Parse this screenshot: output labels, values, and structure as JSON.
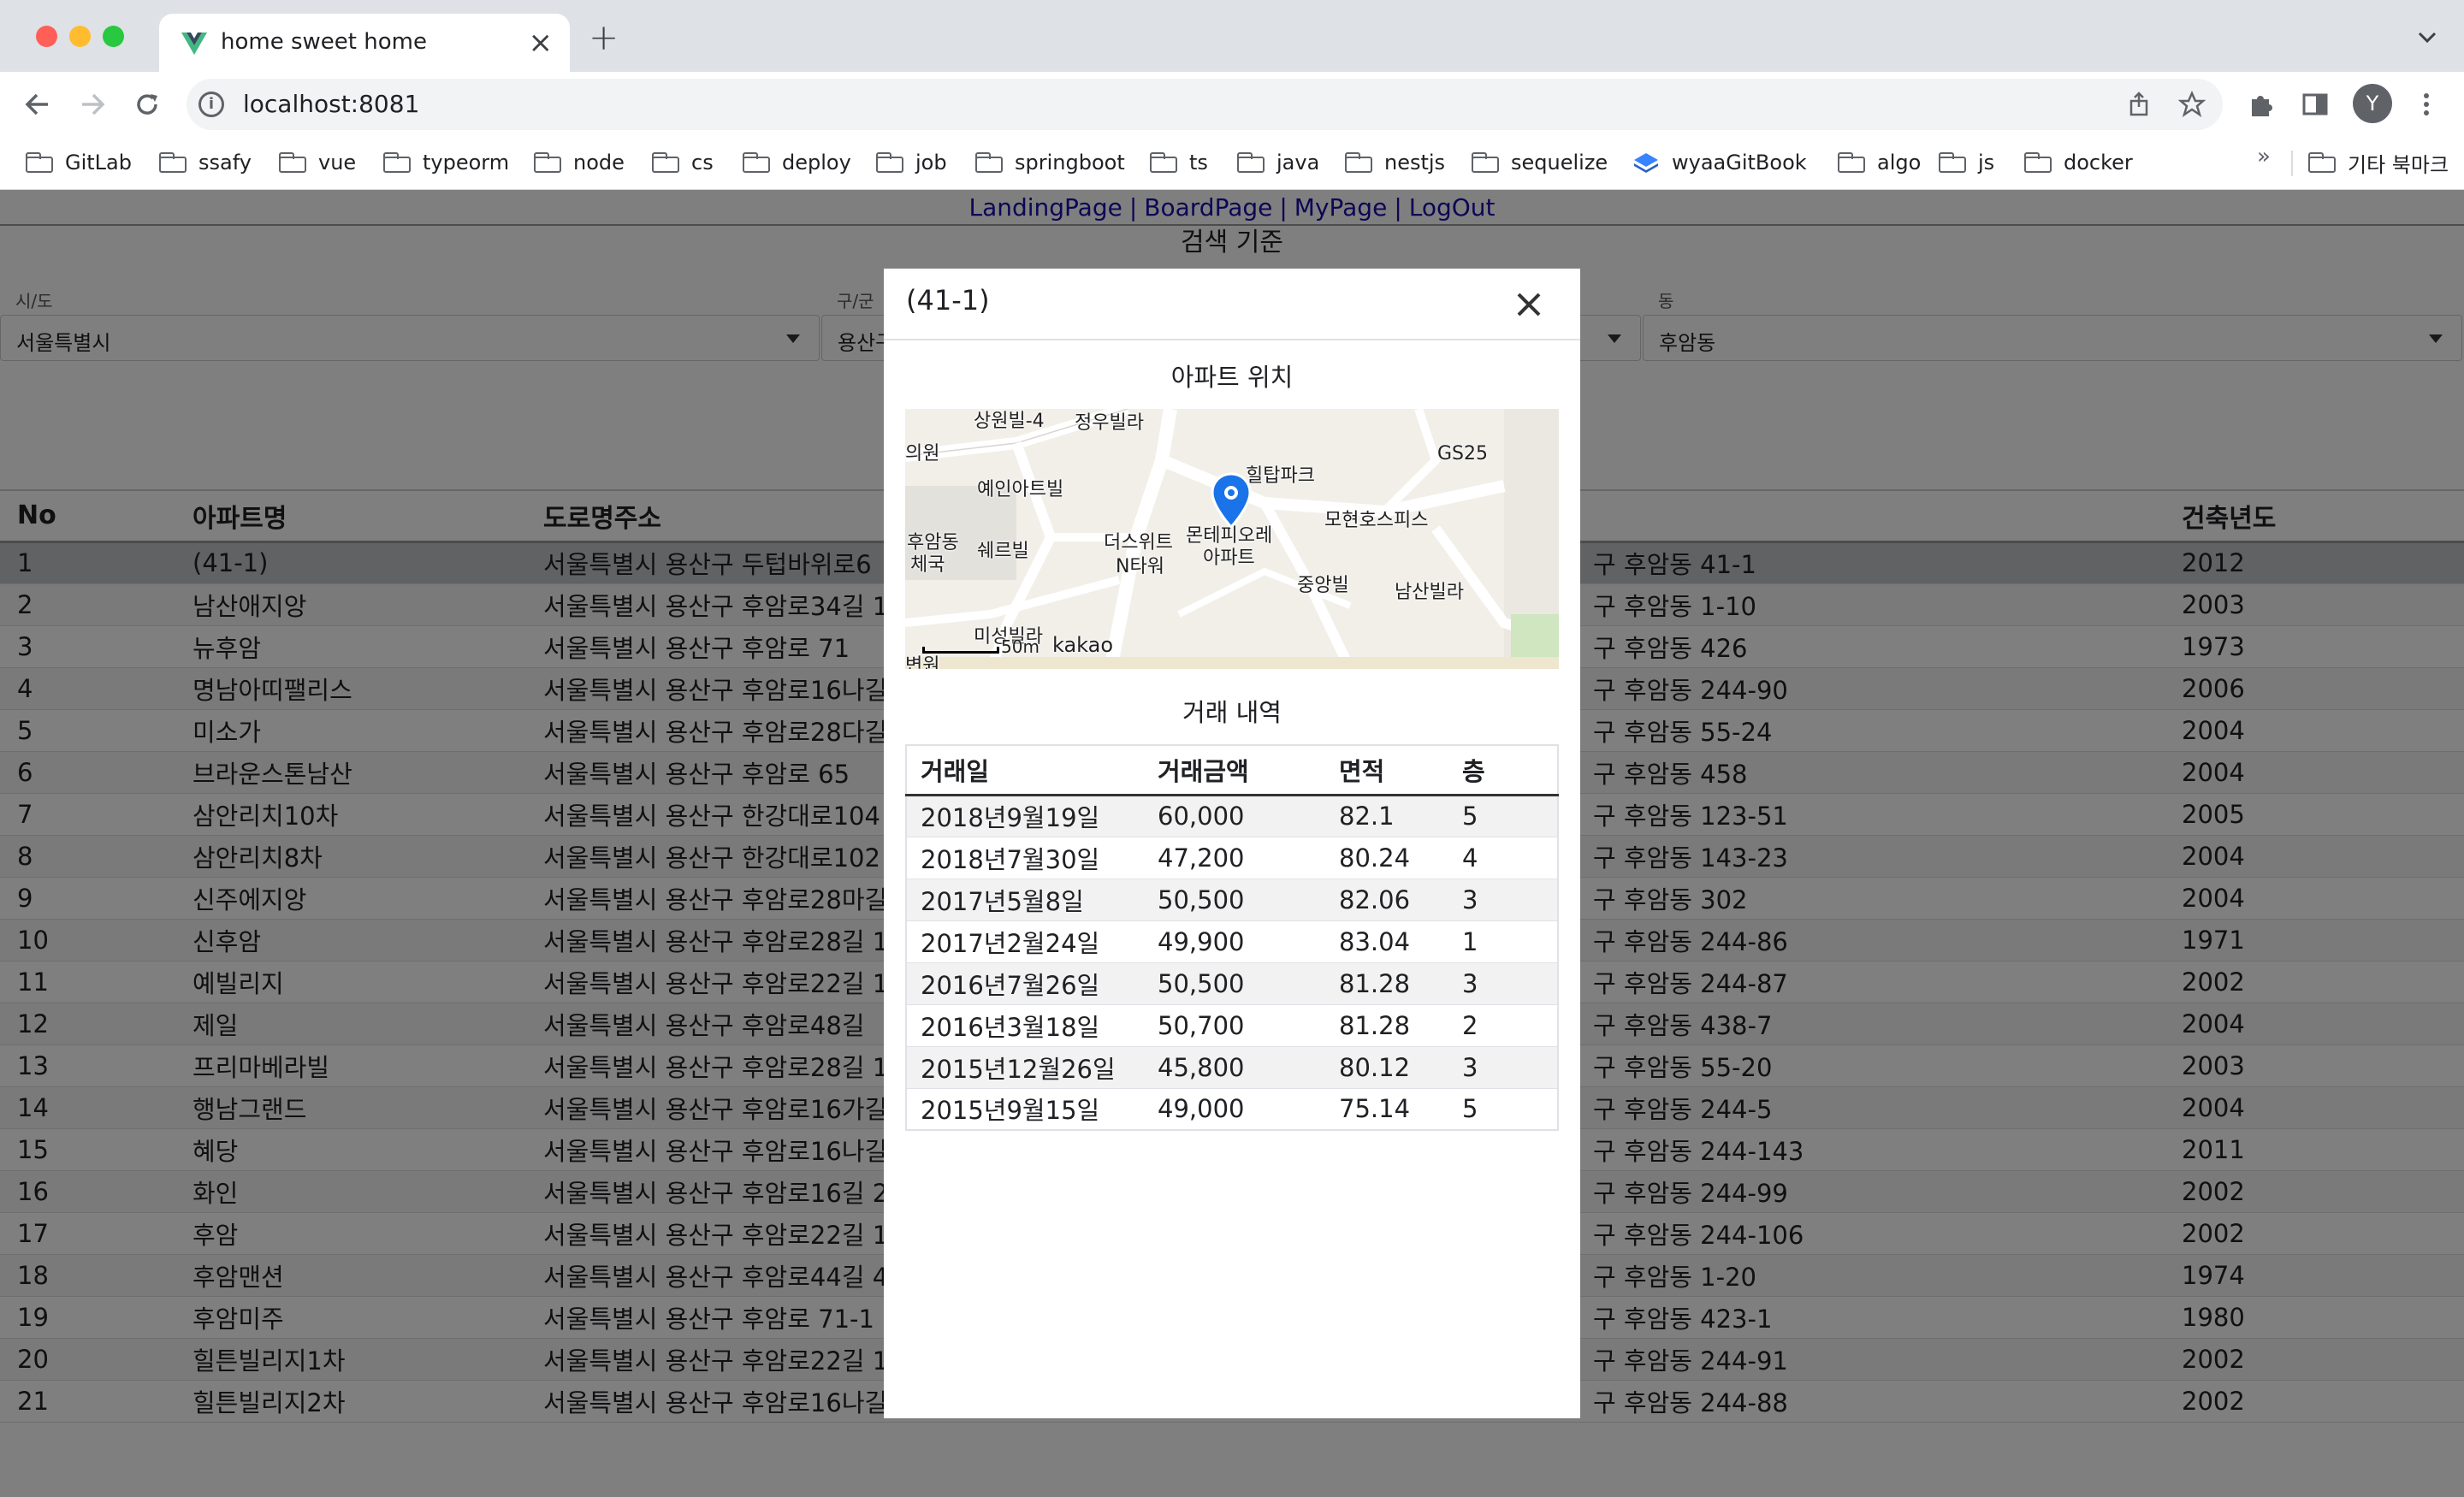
{
  "browser": {
    "tab_title": "home sweet home",
    "url": "localhost:8081",
    "avatar_letter": "Y",
    "bookmarks": [
      "GitLab",
      "ssafy",
      "vue",
      "typeorm",
      "node",
      "cs",
      "deploy",
      "job",
      "springboot",
      "ts",
      "java",
      "nestjs",
      "sequelize",
      "wyaaGitBook",
      "algo",
      "js",
      "docker"
    ],
    "bookmarks_more": "»",
    "other_bookmarks": "기타 북마크"
  },
  "nav": {
    "landing": "LandingPage",
    "board": "BoardPage",
    "mypage": "MyPage",
    "logout": "LogOut",
    "separator": "|"
  },
  "search": {
    "title": "검색 기준",
    "sido_label": "시/도",
    "sido_value": "서울특별시",
    "gugun_label": "구/군",
    "gugun_value": "용산구",
    "dong_label": "동",
    "dong_value": "후암동"
  },
  "table": {
    "headers": [
      "No",
      "아파트명",
      "도로명주소",
      "",
      "건축년도"
    ],
    "rows": [
      [
        "1",
        "(41-1)",
        "서울특별시 용산구 두텁바위로6",
        "구 후암동 41-1",
        "2012"
      ],
      [
        "2",
        "남산애지앙",
        "서울특별시 용산구 후암로34길 1",
        "구 후암동 1-10",
        "2003"
      ],
      [
        "3",
        "뉴후암",
        "서울특별시 용산구 후암로 71",
        "구 후암동 426",
        "1973"
      ],
      [
        "4",
        "명남아띠팰리스",
        "서울특별시 용산구 후암로16나길",
        "구 후암동 244-90",
        "2006"
      ],
      [
        "5",
        "미소가",
        "서울특별시 용산구 후암로28다길",
        "구 후암동 55-24",
        "2004"
      ],
      [
        "6",
        "브라운스톤남산",
        "서울특별시 용산구 후암로 65",
        "구 후암동 458",
        "2004"
      ],
      [
        "7",
        "삼안리치10차",
        "서울특별시 용산구 한강대로104",
        "구 후암동 123-51",
        "2005"
      ],
      [
        "8",
        "삼안리치8차",
        "서울특별시 용산구 한강대로102",
        "구 후암동 143-23",
        "2004"
      ],
      [
        "9",
        "신주에지앙",
        "서울특별시 용산구 후암로28마길",
        "구 후암동 302",
        "2004"
      ],
      [
        "10",
        "신후암",
        "서울특별시 용산구 후암로28길 1",
        "구 후암동 244-86",
        "1971"
      ],
      [
        "11",
        "예빌리지",
        "서울특별시 용산구 후암로22길 1",
        "구 후암동 244-87",
        "2002"
      ],
      [
        "12",
        "제일",
        "서울특별시 용산구 후암로48길",
        "구 후암동 438-7",
        "2004"
      ],
      [
        "13",
        "프리마베라빌",
        "서울특별시 용산구 후암로28길 1",
        "구 후암동 55-20",
        "2003"
      ],
      [
        "14",
        "행남그랜드",
        "서울특별시 용산구 후암로16가길",
        "구 후암동 244-5",
        "2004"
      ],
      [
        "15",
        "혜당",
        "서울특별시 용산구 후암로16나길",
        "구 후암동 244-143",
        "2011"
      ],
      [
        "16",
        "화인",
        "서울특별시 용산구 후암로16길 2",
        "구 후암동 244-99",
        "2002"
      ],
      [
        "17",
        "후암",
        "서울특별시 용산구 후암로22길 1",
        "구 후암동 244-106",
        "2002"
      ],
      [
        "18",
        "후암맨션",
        "서울특별시 용산구 후암로44길 4",
        "구 후암동 1-20",
        "1974"
      ],
      [
        "19",
        "후암미주",
        "서울특별시 용산구 후암로 71-1",
        "구 후암동 423-1",
        "1980"
      ],
      [
        "20",
        "힐튼빌리지1차",
        "서울특별시 용산구 후암로22길 1",
        "구 후암동 244-91",
        "2002"
      ],
      [
        "21",
        "힐튼빌리지2차",
        "서울특별시 용산구 후암로16나길",
        "구 후암동 244-88",
        "2002"
      ]
    ]
  },
  "modal": {
    "title": "(41-1)",
    "map_title": "아파트 위치",
    "map_labels": [
      "상원빌-4",
      "정우빌라",
      "의원",
      "예인아트빌",
      "힐탑파크",
      "GS25",
      "모현호스피스",
      "후암동",
      "체국",
      "쉐르빌",
      "더스위트",
      "N타워",
      "몬테피오레",
      "아파트",
      "중앙빌",
      "남산빌라",
      "미성빌라",
      "50m",
      "kakao",
      "변원"
    ],
    "deal_title": "거래 내역",
    "deal_headers": [
      "거래일",
      "거래금액",
      "면적",
      "층"
    ],
    "deals": [
      [
        "2018년9월19일",
        "60,000",
        "82.1",
        "5"
      ],
      [
        "2018년7월30일",
        "47,200",
        "80.24",
        "4"
      ],
      [
        "2017년5월8일",
        "50,500",
        "82.06",
        "3"
      ],
      [
        "2017년2월24일",
        "49,900",
        "83.04",
        "1"
      ],
      [
        "2016년7월26일",
        "50,500",
        "81.28",
        "3"
      ],
      [
        "2016년3월18일",
        "50,700",
        "81.28",
        "2"
      ],
      [
        "2015년12월26일",
        "45,800",
        "80.12",
        "3"
      ],
      [
        "2015년9월15일",
        "49,000",
        "75.14",
        "5"
      ]
    ]
  },
  "colors": {
    "accent_link": "#1a0dab",
    "map_marker": "#1a73e8"
  }
}
